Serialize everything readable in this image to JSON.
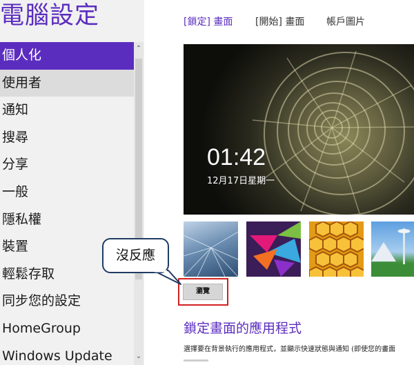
{
  "app": {
    "title": "電腦設定"
  },
  "nav": {
    "items": [
      {
        "label": "個人化"
      },
      {
        "label": "使用者"
      },
      {
        "label": "通知"
      },
      {
        "label": "搜尋"
      },
      {
        "label": "分享"
      },
      {
        "label": "一般"
      },
      {
        "label": "隱私權"
      },
      {
        "label": "裝置"
      },
      {
        "label": "輕鬆存取"
      },
      {
        "label": "同步您的設定"
      },
      {
        "label": "HomeGroup"
      },
      {
        "label": "Windows Update"
      }
    ],
    "selected_index": 0
  },
  "tabs": [
    {
      "label": "[鎖定] 畫面",
      "active": true
    },
    {
      "label": "[開始] 畫面",
      "active": false
    },
    {
      "label": "帳戶圖片",
      "active": false
    }
  ],
  "lock_screen": {
    "time": "01:42",
    "date": "12月17日星期一"
  },
  "thumbnails": [
    {
      "name": "tunnel-motion"
    },
    {
      "name": "colorful-geometric"
    },
    {
      "name": "honeycomb"
    },
    {
      "name": "space-needle"
    }
  ],
  "browse": {
    "label": "瀏覽"
  },
  "annotation": {
    "callout_text": "沒反應"
  },
  "lock_apps": {
    "title": "鎖定畫面的應用程式",
    "description": "選擇要在背景執行的應用程式，並顯示快速狀態與通知 (即使您的畫面"
  },
  "colors": {
    "accent": "#5b2dbf",
    "sidebar_bg": "#f1f1f1",
    "highlight": "#d21f1f",
    "callout_border": "#1f3b63"
  }
}
